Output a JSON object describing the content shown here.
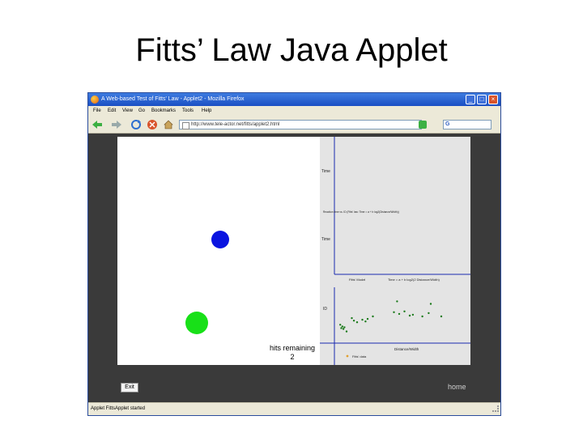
{
  "slide": {
    "title": "Fitts’ Law Java Applet"
  },
  "window": {
    "title": "A Web-based Test of Fitts' Law - Applet2 - Mozilla Firefox",
    "buttons": {
      "minimize": "_",
      "maximize": "□",
      "close": "×"
    }
  },
  "menu": [
    "File",
    "Edit",
    "View",
    "Go",
    "Bookmarks",
    "Tools",
    "Help"
  ],
  "toolbar": {
    "url": "http://www.tele-actor.net/fitts/applet2.html"
  },
  "applet": {
    "hits_label": "hits remaining",
    "hits_count": "2",
    "targets": [
      {
        "name": "blue-target",
        "color": "#0a14e0"
      },
      {
        "name": "green-target",
        "color": "#18e018"
      }
    ],
    "plot": {
      "top_y_label": "Time",
      "top_caption": "Reaction time vs. ID (Fitts' law: Time = a + b log2(Distance/Width))",
      "mid_y_label": "Time",
      "bottom_left_caption": "Fitts' Model",
      "bottom_right_caption": "Time = a + b log2(2 Distance/Width)",
      "bottom_y_label": "ID",
      "x_label": "Distance/Width",
      "legend": "Fitts' data",
      "point_color": "#1a7a1a",
      "axis_color": "#1a2ab0"
    },
    "exit_label": "Exit",
    "home_label": "home"
  },
  "status": {
    "text": "Applet FittsApplet started"
  },
  "chart_data": {
    "type": "scatter",
    "series": [
      {
        "name": "Fitts' data",
        "points": [
          [
            0.4,
            2.0
          ],
          [
            0.5,
            1.6
          ],
          [
            0.6,
            1.8
          ],
          [
            0.7,
            1.5
          ],
          [
            0.8,
            1.7
          ],
          [
            1.0,
            1.2
          ],
          [
            1.5,
            2.8
          ],
          [
            1.7,
            2.5
          ],
          [
            2.0,
            2.3
          ],
          [
            2.5,
            2.6
          ],
          [
            2.8,
            2.4
          ],
          [
            3.0,
            2.7
          ],
          [
            3.5,
            3.0
          ],
          [
            5.5,
            3.5
          ],
          [
            6.0,
            3.3
          ],
          [
            6.5,
            3.6
          ],
          [
            7.0,
            3.1
          ],
          [
            7.3,
            3.2
          ],
          [
            8.2,
            3.0
          ],
          [
            8.8,
            3.4
          ],
          [
            9.0,
            4.5
          ],
          [
            10.0,
            3.0
          ],
          [
            5.8,
            4.8
          ]
        ]
      }
    ],
    "xlabel": "Distance/Width",
    "ylabel": "ID",
    "xlim": [
      0,
      12
    ],
    "ylim": [
      0,
      6
    ],
    "legend_position": "bottom-left"
  }
}
